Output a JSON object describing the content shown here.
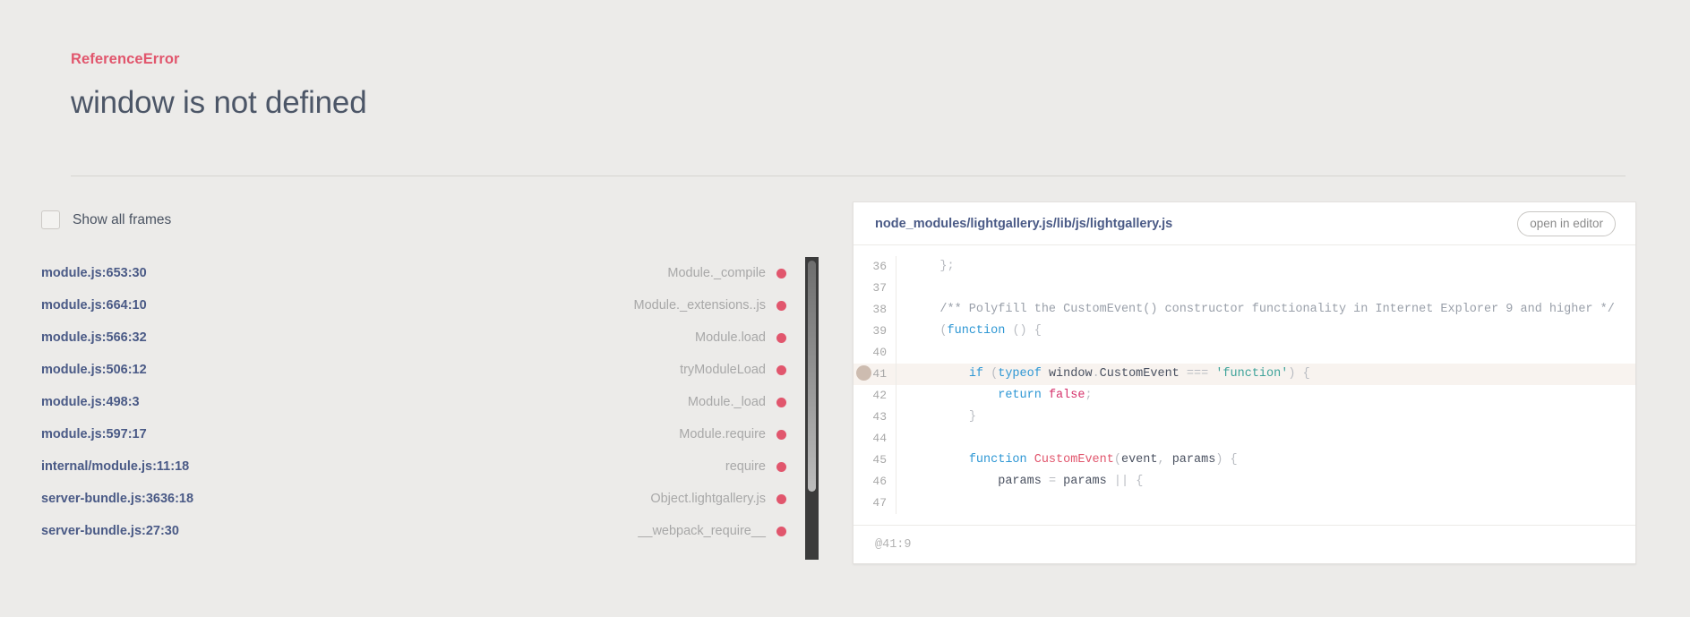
{
  "error": {
    "type": "ReferenceError",
    "message": "window is not defined",
    "accent_color": "#e1566d"
  },
  "frames_panel": {
    "toggle_label": "Show all frames",
    "toggle_checked": false,
    "frames": [
      {
        "file": "module.js:653:30",
        "fn": "Module._compile"
      },
      {
        "file": "module.js:664:10",
        "fn": "Module._extensions..js"
      },
      {
        "file": "module.js:566:32",
        "fn": "Module.load"
      },
      {
        "file": "module.js:506:12",
        "fn": "tryModuleLoad"
      },
      {
        "file": "module.js:498:3",
        "fn": "Module._load"
      },
      {
        "file": "module.js:597:17",
        "fn": "Module.require"
      },
      {
        "file": "internal/module.js:11:18",
        "fn": "require"
      },
      {
        "file": "server-bundle.js:3636:18",
        "fn": "Object.lightgallery.js"
      },
      {
        "file": "server-bundle.js:27:30",
        "fn": "__webpack_require__"
      }
    ]
  },
  "code_panel": {
    "path": "node_modules/lightgallery.js/lib/js/lightgallery.js",
    "open_in_editor_label": "open in editor",
    "footer_location": "@41:9",
    "highlight_line": 41,
    "lines": [
      {
        "num": "36",
        "text": "    };"
      },
      {
        "num": "37",
        "text": ""
      },
      {
        "num": "38",
        "text": "    /** Polyfill the CustomEvent() constructor functionality in Internet Explorer 9 and higher */"
      },
      {
        "num": "39",
        "text": "    (function () {"
      },
      {
        "num": "40",
        "text": ""
      },
      {
        "num": "41",
        "text": "        if (typeof window.CustomEvent === 'function') {"
      },
      {
        "num": "42",
        "text": "            return false;"
      },
      {
        "num": "43",
        "text": "        }"
      },
      {
        "num": "44",
        "text": ""
      },
      {
        "num": "45",
        "text": "        function CustomEvent(event, params) {"
      },
      {
        "num": "46",
        "text": "            params = params || {"
      },
      {
        "num": "47",
        "text": ""
      }
    ]
  }
}
